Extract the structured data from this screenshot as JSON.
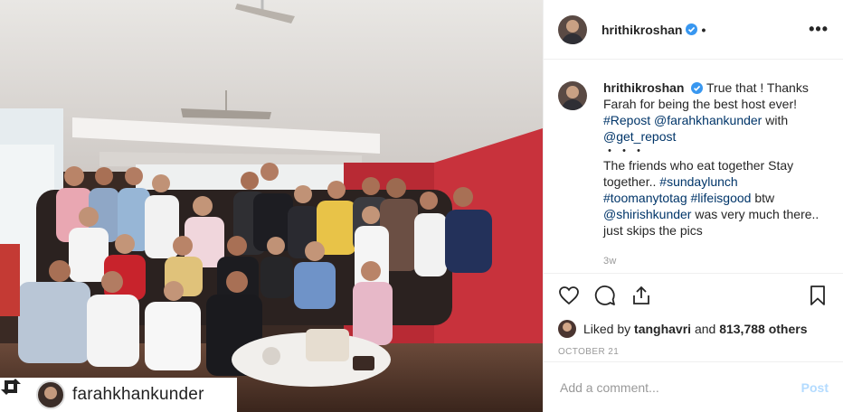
{
  "header": {
    "username": "hrithikroshan",
    "separator": "•"
  },
  "caption": {
    "username": "hrithikroshan",
    "line1": "True that ! Thanks Farah for being the best host ever!",
    "hashtag_repost": "#Repost",
    "mention_farah": "@farahkhankunder",
    "with": "with",
    "mention_getrepost": "@get_repost",
    "dots": "・・・",
    "line2": "The friends who eat together Stay together..",
    "hashtag_sundaylunch": "#sundaylunch",
    "hashtag_toomanytotag": "#toomanytotag",
    "hashtag_lifeisgood": "#lifeisgood",
    "btw": "btw",
    "mention_shirish": "@shirishkunder",
    "line3": "was very much there.. just skips the pics",
    "time": "3w"
  },
  "likes": {
    "prefix": "Liked by",
    "user": "tanghavri",
    "and": "and",
    "count": "813,788 others"
  },
  "date": "OCTOBER 21",
  "comment": {
    "placeholder": "Add a comment...",
    "post_label": "Post"
  },
  "repost": {
    "username": "farahkhankunder"
  },
  "icons": {
    "more": "more-options-icon",
    "verified": "verified-badge-icon",
    "like": "heart-icon",
    "comment": "comment-icon",
    "share": "share-icon",
    "save": "bookmark-icon",
    "repost": "repost-icon"
  },
  "colors": {
    "link": "#003569",
    "verified": "#3897f0",
    "post_button": "#b3dbff",
    "muted": "#999999",
    "wall_red": "#c8323c"
  }
}
